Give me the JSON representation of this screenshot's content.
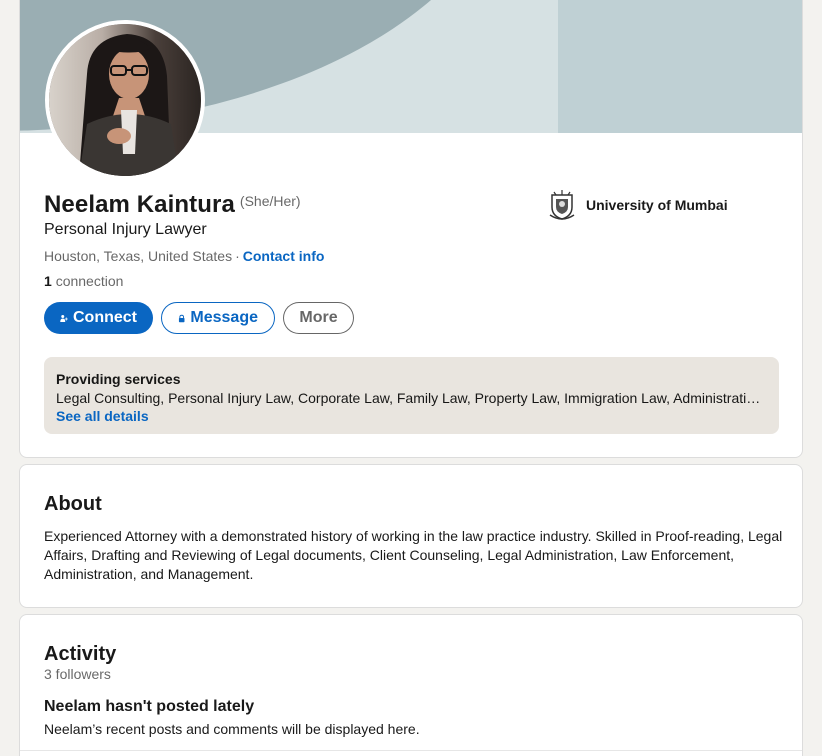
{
  "profile": {
    "name": "Neelam Kaintura",
    "pronouns": "(She/Her)",
    "headline": "Personal Injury Lawyer",
    "location": "Houston, Texas, United States",
    "separator": "·",
    "contact_info": "Contact info",
    "connections_count": "1",
    "connections_label": "connection",
    "education": "University of Mumbai",
    "avatar_icon": "profile-photo"
  },
  "actions": {
    "connect": "Connect",
    "message": "Message",
    "more": "More"
  },
  "services": {
    "title": "Providing services",
    "list": "Legal Consulting, Personal Injury Law, Corporate Law, Family Law, Property Law, Immigration Law, Administrative …",
    "see_all": "See all details"
  },
  "about": {
    "title": "About",
    "text": "Experienced Attorney with a demonstrated history of working in the law practice industry. Skilled in Proof-reading, Legal Affairs, Drafting and Reviewing of Legal documents, Client Counseling, Legal Administration, Law Enforcement, Administration, and Management."
  },
  "activity": {
    "title": "Activity",
    "followers": "3 followers",
    "empty_title": "Neelam hasn't posted lately",
    "empty_desc": "Neelam’s recent posts and comments will be displayed here."
  },
  "colors": {
    "brand_blue": "#0a66c2",
    "services_bg": "#e9e5df",
    "page_bg": "#f3f2ef"
  }
}
